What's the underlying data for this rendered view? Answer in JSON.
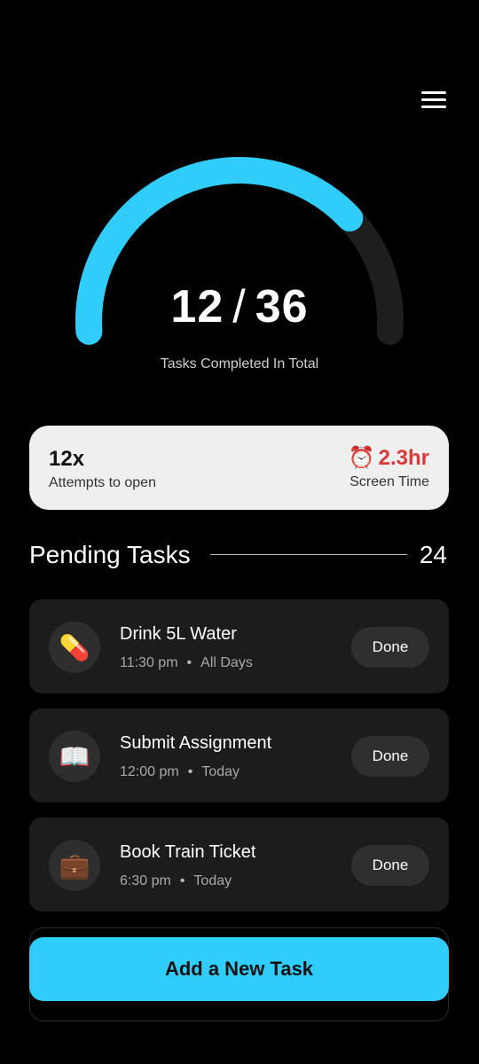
{
  "header": {
    "menu_icon": "hamburger-menu-icon"
  },
  "progress": {
    "completed": "12",
    "separator": "/",
    "total": "36",
    "caption": "Tasks Completed In Total",
    "completed_value": 12,
    "total_value": 36,
    "arc_color": "#30cdfb",
    "track_color": "#1e1e1e"
  },
  "stats": {
    "attempts": "12x",
    "attempts_label": "Attempts to open",
    "alarm_icon": "⏰",
    "screen_time": "2.3hr",
    "screen_time_label": "Screen Time",
    "screen_time_color": "#d83a3a"
  },
  "pending": {
    "title": "Pending Tasks",
    "count": "24"
  },
  "tasks": [
    {
      "icon": "💊",
      "icon_name": "pill-icon",
      "title": "Drink 5L Water",
      "time": "11:30 pm",
      "dot": "•",
      "schedule": "All Days",
      "button": "Done"
    },
    {
      "icon": "📖",
      "icon_name": "open-book-icon",
      "title": "Submit Assignment",
      "time": "12:00 pm",
      "dot": "•",
      "schedule": "Today",
      "button": "Done"
    },
    {
      "icon": "💼",
      "icon_name": "briefcase-icon",
      "title": "Book Train Ticket",
      "time": "6:30 pm",
      "dot": "•",
      "schedule": "Today",
      "button": "Done"
    }
  ],
  "add_button": {
    "label": "Add a New Task",
    "color": "#30cdfb"
  }
}
